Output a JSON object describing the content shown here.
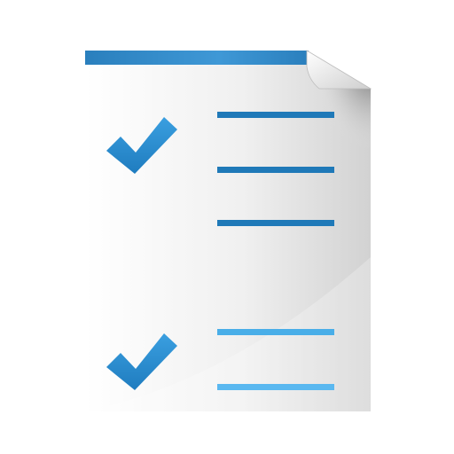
{
  "icon": {
    "name": "checklist-document-icon",
    "colors": {
      "header_bar": "#2c86c4",
      "check": "#2b8fd0",
      "line_dark": "#1f79b8",
      "line_light": "#5ab8f0",
      "page_light": "#ffffff",
      "page_shadow": "#d6d6d6",
      "fold": "#f2f2f2"
    },
    "items": [
      {
        "checked": true,
        "line_count": 3
      },
      {
        "checked": true,
        "line_count": 2
      }
    ]
  }
}
